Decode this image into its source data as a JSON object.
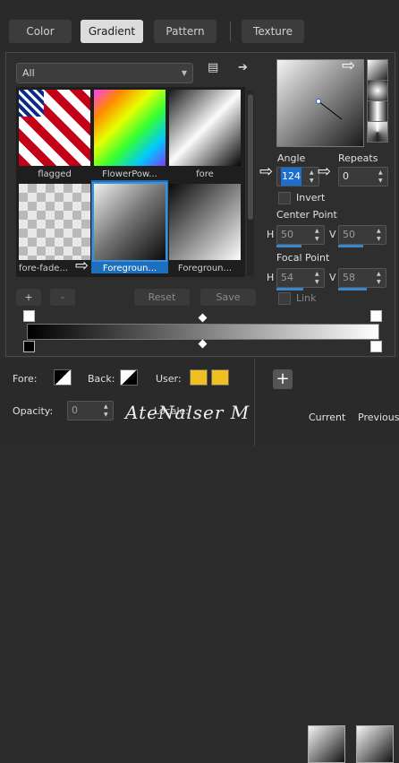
{
  "tabs": [
    {
      "label": "Color"
    },
    {
      "label": "Gradient",
      "active": true
    },
    {
      "label": "Pattern"
    },
    {
      "label": "Texture"
    }
  ],
  "library": {
    "dropdown_value": "All"
  },
  "gradients": [
    {
      "name": "flagged"
    },
    {
      "name": "FlowerPow..."
    },
    {
      "name": "fore"
    },
    {
      "name": "fore-fade..."
    },
    {
      "name": "Foregroun...",
      "selected": true
    },
    {
      "name": "Foregroun..."
    }
  ],
  "actions": {
    "add": "+",
    "remove": "-",
    "reset": "Reset",
    "save": "Save"
  },
  "angle": {
    "label": "Angle",
    "value": "124"
  },
  "repeats": {
    "label": "Repeats",
    "value": "0"
  },
  "invert": {
    "label": "Invert",
    "checked": false
  },
  "center_point": {
    "label": "Center Point",
    "h_label": "H",
    "h": "50",
    "v_label": "V",
    "v": "50"
  },
  "focal_point": {
    "label": "Focal Point",
    "h_label": "H",
    "h": "54",
    "v_label": "V",
    "v": "58"
  },
  "link": {
    "label": "Link"
  },
  "bottom": {
    "fore_label": "Fore:",
    "back_label": "Back:",
    "user_label": "User:",
    "opacity_label": "Opacity:",
    "opacity_value": "0",
    "locale_label": "Locale:",
    "current_label": "Current",
    "previous_label": "Previous",
    "add_symbol": "+",
    "user_color": "#f0c020"
  },
  "signature": "AteNalser M"
}
